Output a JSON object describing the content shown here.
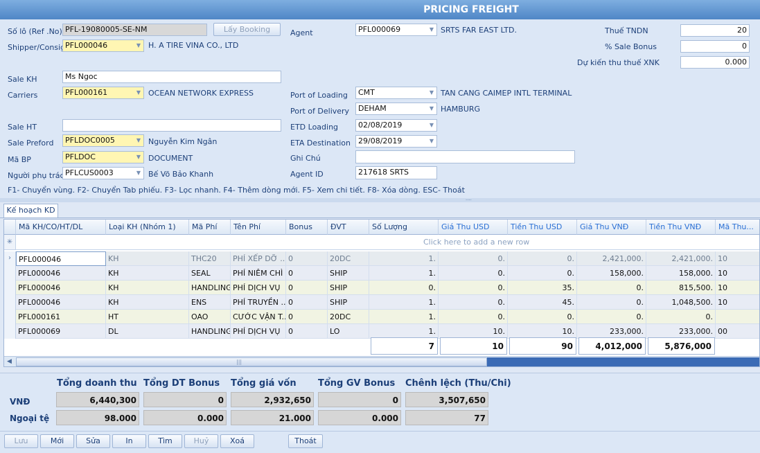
{
  "title": "PRICING FREIGHT",
  "form": {
    "so_lo": {
      "label": "Số lô (Ref .No)",
      "value": "PFL-19080005-SE-NM"
    },
    "lay_booking": "Lấy Booking",
    "shipper": {
      "label": "Shipper/Consign",
      "code": "PFL000046",
      "name": "H. A TIRE VINA CO., LTD"
    },
    "agent": {
      "label": "Agent",
      "code": "PFL000069",
      "name": "SRTS FAR EAST LTD."
    },
    "thue_tndn": {
      "label": "Thuế TNDN",
      "value": "20"
    },
    "sale_bonus": {
      "label": "% Sale Bonus",
      "value": "0"
    },
    "du_kien": {
      "label": "Dự kiến thu thuế XNK",
      "value": "0.000"
    },
    "sale_kh": {
      "label": "Sale KH",
      "value": "Ms Ngoc"
    },
    "carriers": {
      "label": "Carriers",
      "code": "PFL000161",
      "name": "OCEAN NETWORK EXPRESS"
    },
    "pol": {
      "label": "Port of Loading",
      "code": "CMT",
      "name": "TAN CANG CAIMEP INTL TERMINAL"
    },
    "pod": {
      "label": "Port of Delivery",
      "code": "DEHAM",
      "name": "HAMBURG"
    },
    "sale_ht": {
      "label": "Sale HT",
      "value": ""
    },
    "etd": {
      "label": "ETD Loading",
      "value": "02/08/2019"
    },
    "sale_preford": {
      "label": "Sale Preford",
      "code": "PFLDOC0005",
      "name": "Nguyễn Kim Ngân"
    },
    "eta": {
      "label": "ETA Destination",
      "value": "29/08/2019"
    },
    "ma_bp": {
      "label": "Mã BP",
      "code": "PFLDOC",
      "name": "DOCUMENT"
    },
    "ghi_chu": {
      "label": "Ghi Chú",
      "value": ""
    },
    "nguoi_phu_trach": {
      "label": "Người phụ trách",
      "code": "PFLCUS0003",
      "name": "Bế Võ Bảo Khanh"
    },
    "agent_id": {
      "label": "Agent ID",
      "value": "217618 SRTS"
    }
  },
  "hint": "F1- Chuyển vùng. F2- Chuyển Tab phiếu. F3- Lọc nhanh. F4- Thêm dòng mới. F5- Xem chi tiết. F8- Xóa dòng. ESC- Thoát",
  "tab": "Kế hoạch KD",
  "grid": {
    "columns": [
      "Mã KH/CO/HT/DL",
      "Loại KH (Nhóm 1)",
      "Mã Phí",
      "Tên Phí",
      "Bonus",
      "ĐVT",
      "Số Lượng",
      "Giá Thu USD",
      "Tiền Thu USD",
      "Giá Thu VNĐ",
      "Tiền Thu VNĐ",
      "Mã Thu..."
    ],
    "new_row": "Click here to add a new row",
    "rows": [
      [
        "PFL000046",
        "KH",
        "THC20",
        "PHÍ XẾP DỠ ...",
        "0",
        "20DC",
        "1.",
        "0.",
        "0.",
        "2,421,000.",
        "2,421,000.",
        "10"
      ],
      [
        "PFL000046",
        "KH",
        "SEAL",
        "PHÍ NIÊM CHÌ",
        "0",
        "SHIP",
        "1.",
        "0.",
        "0.",
        "158,000.",
        "158,000.",
        "10"
      ],
      [
        "PFL000046",
        "KH",
        "HANDLING",
        "PHÍ DỊCH VỤ",
        "0",
        "SHIP",
        "0.",
        "0.",
        "35.",
        "0.",
        "815,500.",
        "10"
      ],
      [
        "PFL000046",
        "KH",
        "ENS",
        "PHÍ TRUYỀN ...",
        "0",
        "SHIP",
        "1.",
        "0.",
        "45.",
        "0.",
        "1,048,500.",
        "10"
      ],
      [
        "PFL000161",
        "HT",
        "OAO",
        "CƯỚC VẬN T...",
        "0",
        "20DC",
        "1.",
        "0.",
        "0.",
        "0.",
        "0.",
        ""
      ],
      [
        "PFL000069",
        "DL",
        "HANDLING",
        "PHÍ DỊCH VỤ",
        "0",
        "LO",
        "1.",
        "10.",
        "10.",
        "233,000.",
        "233,000.",
        "00"
      ]
    ],
    "totals": [
      "7",
      "10",
      "90",
      "4,012,000",
      "5,876,000"
    ]
  },
  "summary": {
    "headers": [
      "Tổng doanh thu",
      "Tổng DT Bonus",
      "Tổng giá vốn",
      "Tổng GV Bonus",
      "Chênh lệch (Thu/Chi)"
    ],
    "vnd_label": "VNĐ",
    "vnd": [
      "6,440,300",
      "0",
      "2,932,650",
      "0",
      "3,507,650"
    ],
    "ngoai_te_label": "Ngoại tệ",
    "ngoai_te": [
      "98.000",
      "0.000",
      "21.000",
      "0.000",
      "77"
    ]
  },
  "buttons": {
    "luu": "Lưu",
    "moi": "Mới",
    "sua": "Sửa",
    "in": "In",
    "tim": "Tìm",
    "huy": "Huỷ",
    "xoa": "Xoá",
    "thoat": "Thoát"
  }
}
